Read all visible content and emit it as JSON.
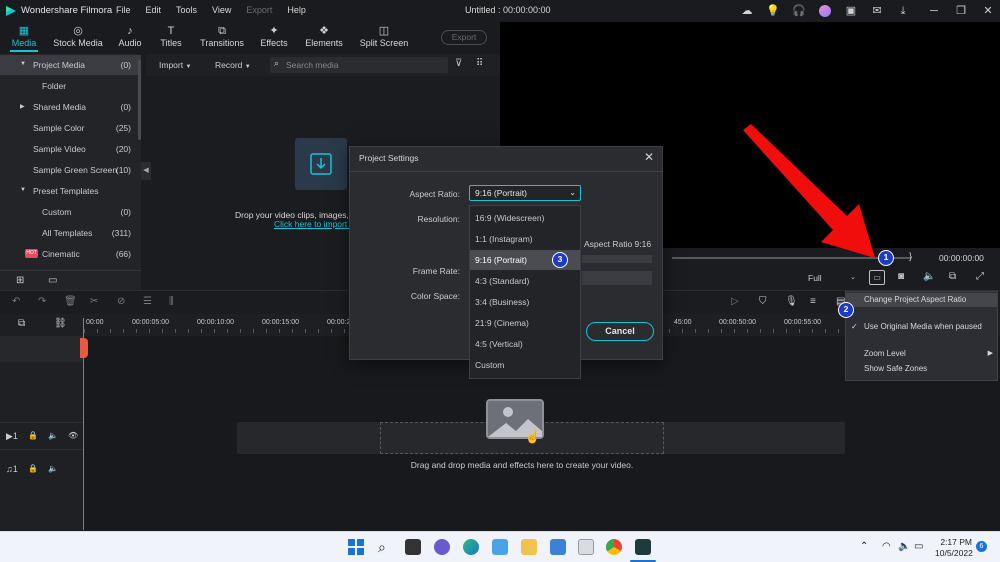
{
  "app": {
    "name": "Wondershare Filmora",
    "document_title": "Untitled : 00:00:00:00"
  },
  "menu": [
    "File",
    "Edit",
    "Tools",
    "View",
    "Export",
    "Help"
  ],
  "toolbar": {
    "tabs": [
      {
        "label": "Media",
        "icon": "media-icon"
      },
      {
        "label": "Stock Media",
        "icon": "stock-media-icon"
      },
      {
        "label": "Audio",
        "icon": "audio-icon"
      },
      {
        "label": "Titles",
        "icon": "titles-icon"
      },
      {
        "label": "Transitions",
        "icon": "transitions-icon"
      },
      {
        "label": "Effects",
        "icon": "effects-icon"
      },
      {
        "label": "Elements",
        "icon": "elements-icon"
      },
      {
        "label": "Split Screen",
        "icon": "split-screen-icon"
      }
    ],
    "export_label": "Export"
  },
  "sidebar": {
    "items": [
      {
        "label": "Project Media",
        "count": "(0)"
      },
      {
        "label": "Folder",
        "count": ""
      },
      {
        "label": "Shared Media",
        "count": "(0)"
      },
      {
        "label": "Sample Color",
        "count": "(25)"
      },
      {
        "label": "Sample Video",
        "count": "(20)"
      },
      {
        "label": "Sample Green Screen",
        "count": "(10)"
      },
      {
        "label": "Preset Templates",
        "count": ""
      },
      {
        "label": "Custom",
        "count": "(0)"
      },
      {
        "label": "All Templates",
        "count": "(311)"
      },
      {
        "label": "Cinematic",
        "count": "(66)"
      }
    ],
    "badge_text": "HOT"
  },
  "media": {
    "import_label": "Import",
    "record_label": "Record",
    "search_placeholder": "Search media",
    "drop_text": "Drop your video clips, images, o",
    "import_link": "Click here to import r"
  },
  "player": {
    "time": "00:00:00:00",
    "quality": "Full",
    "brace": "}"
  },
  "ruler": [
    "00:00",
    "00:00:05:00",
    "00:00:10:00",
    "00:00:15:00",
    "00:00:2",
    "45:00",
    "00:00:50:00",
    "00:00:55:00"
  ],
  "tracks": {
    "video_track": "1",
    "audio_track": "1"
  },
  "dialog": {
    "title": "Project Settings",
    "aspect_label": "Aspect Ratio:",
    "aspect_value": "9:16 (Portrait)",
    "resolution_label": "Resolution:",
    "framerate_label": "Frame Rate:",
    "colorspace_label": "Color Space:",
    "aspect_hint": "Aspect Ratio  9:16",
    "cancel_label": "Cancel",
    "options": [
      "16:9 (Widescreen)",
      "1:1 (Instagram)",
      "9:16 (Portrait)",
      "4:3 (Standard)",
      "3:4 (Business)",
      "21:9 (Cinema)",
      "4:5 (Vertical)",
      "Custom"
    ],
    "selected_index": 2
  },
  "context_menu": {
    "items": [
      "Change Project Aspect Ratio",
      "Use Original Media when paused",
      "Zoom Level",
      "Show Safe Zones"
    ],
    "checked": "Use Original Media when paused"
  },
  "callouts": [
    "1",
    "2",
    "3"
  ],
  "timeline": {
    "drop_hint": "Drag and drop media and effects here to create your video."
  },
  "taskbar": {
    "time": "2:17 PM",
    "date": "10/5/2022",
    "notification_count": "6"
  },
  "colors": {
    "accent": "#19c3d6",
    "arrow": "#f20d0d",
    "callout": "#1d3ac9",
    "playhead": "#e8593f"
  }
}
